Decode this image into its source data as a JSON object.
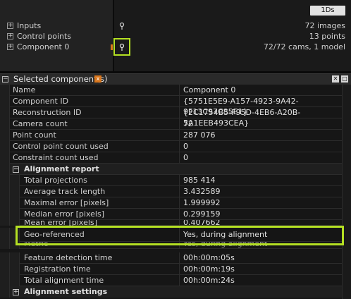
{
  "top": {
    "view_button": "1Ds",
    "tree": [
      {
        "label": "Inputs",
        "value": "72 images"
      },
      {
        "label": "Control points",
        "value": "13 points"
      },
      {
        "label": "Component 0",
        "value": "72/72 cams, 1 model"
      }
    ]
  },
  "panel": {
    "title": "Selected component(s)",
    "rows": [
      {
        "name": "Name",
        "value": "Component 0"
      },
      {
        "name": "Component ID",
        "value": "{5751E5E9-A157-4923-9A42-9F13C97C85E1}"
      },
      {
        "name": "Reconstruction ID",
        "value": "{2C1754B5-F95D-4EB6-A20B-5A1EEB493CEA}"
      },
      {
        "name": "Camera count",
        "value": "72"
      },
      {
        "name": "Point count",
        "value": "287 076"
      },
      {
        "name": "Control point count used",
        "value": "0"
      },
      {
        "name": "Constraint count used",
        "value": "0"
      }
    ],
    "alignment_report": {
      "label": "Alignment report",
      "rows": [
        {
          "name": "Total projections",
          "value": "985 414"
        },
        {
          "name": "Average track length",
          "value": "3.432589"
        },
        {
          "name": "Maximal error [pixels]",
          "value": "1.999992"
        },
        {
          "name": "Median error [pixels]",
          "value": "0.299159"
        },
        {
          "name": "Mean error [pixels]",
          "value": "0.407662"
        },
        {
          "name": "Geo-referenced",
          "value": "Yes, during alignment"
        },
        {
          "name": "Metric",
          "value": "Yes, during alignment"
        },
        {
          "name": "Feature detection time",
          "value": "00h:00m:05s"
        },
        {
          "name": "Registration time",
          "value": "00h:00m:19s"
        },
        {
          "name": "Total alignment time",
          "value": "00h:00m:24s"
        }
      ]
    },
    "alignment_settings": {
      "label": "Alignment settings"
    }
  },
  "colors": {
    "highlight": "#b4e023",
    "accent_orange": "#d9761c"
  }
}
